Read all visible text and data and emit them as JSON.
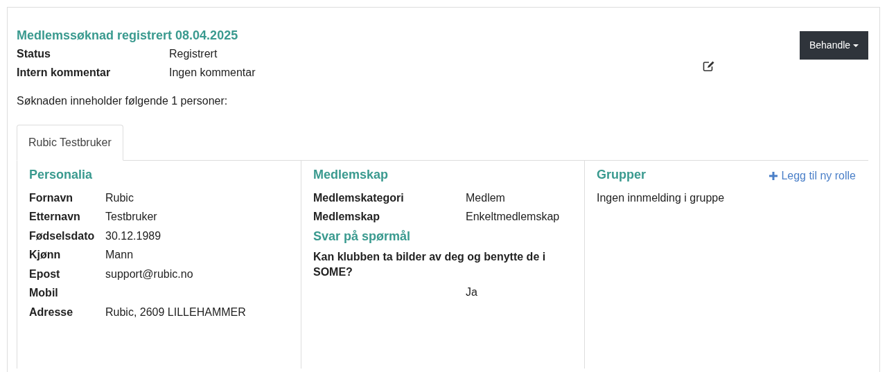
{
  "title": "Medlemssøknad registrert 08.04.2025",
  "action_button": "Behandle",
  "summary": [
    {
      "label": "Status",
      "value": "Registrert"
    },
    {
      "label": "Intern kommentar",
      "value": "Ingen kommentar"
    }
  ],
  "intro": "Søknaden inneholder følgende 1 personer:",
  "tabs": [
    {
      "label": "Rubic Testbruker",
      "selected": true
    }
  ],
  "personalia": {
    "title": "Personalia",
    "fields": [
      {
        "label": "Fornavn",
        "value": "Rubic"
      },
      {
        "label": "Etternavn",
        "value": "Testbruker"
      },
      {
        "label": "Fødselsdato",
        "value": "30.12.1989"
      },
      {
        "label": "Kjønn",
        "value": "Mann"
      },
      {
        "label": "Epost",
        "value": "support@rubic.no"
      },
      {
        "label": "Mobil"
      },
      {
        "label": "Adresse",
        "value": "Rubic, 2609 LILLEHAMMER"
      }
    ]
  },
  "medlemskap": {
    "title": "Medlemskap",
    "fields": [
      {
        "label": "Medlemskategori",
        "value": "Medlem"
      },
      {
        "label": "Medlemskap",
        "value": "Enkeltmedlemskap"
      }
    ]
  },
  "questions": {
    "title": "Svar på spørmål",
    "items": [
      {
        "question": "Kan klubben ta bilder av deg og benytte de i SOME?",
        "answer": "Ja"
      }
    ]
  },
  "grupper": {
    "title": "Grupper",
    "add_link": "Legg til ny rolle",
    "empty_text": "Ingen innmelding i gruppe"
  }
}
